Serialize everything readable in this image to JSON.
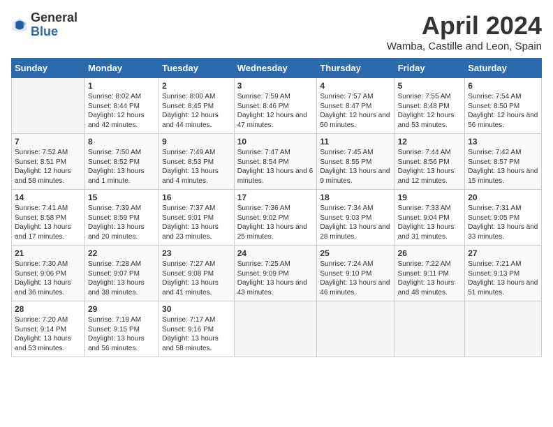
{
  "header": {
    "logo_general": "General",
    "logo_blue": "Blue",
    "month_title": "April 2024",
    "subtitle": "Wamba, Castille and Leon, Spain"
  },
  "days_of_week": [
    "Sunday",
    "Monday",
    "Tuesday",
    "Wednesday",
    "Thursday",
    "Friday",
    "Saturday"
  ],
  "weeks": [
    [
      {
        "num": "",
        "sunrise": "",
        "sunset": "",
        "daylight": "",
        "empty": true
      },
      {
        "num": "1",
        "sunrise": "Sunrise: 8:02 AM",
        "sunset": "Sunset: 8:44 PM",
        "daylight": "Daylight: 12 hours and 42 minutes."
      },
      {
        "num": "2",
        "sunrise": "Sunrise: 8:00 AM",
        "sunset": "Sunset: 8:45 PM",
        "daylight": "Daylight: 12 hours and 44 minutes."
      },
      {
        "num": "3",
        "sunrise": "Sunrise: 7:59 AM",
        "sunset": "Sunset: 8:46 PM",
        "daylight": "Daylight: 12 hours and 47 minutes."
      },
      {
        "num": "4",
        "sunrise": "Sunrise: 7:57 AM",
        "sunset": "Sunset: 8:47 PM",
        "daylight": "Daylight: 12 hours and 50 minutes."
      },
      {
        "num": "5",
        "sunrise": "Sunrise: 7:55 AM",
        "sunset": "Sunset: 8:48 PM",
        "daylight": "Daylight: 12 hours and 53 minutes."
      },
      {
        "num": "6",
        "sunrise": "Sunrise: 7:54 AM",
        "sunset": "Sunset: 8:50 PM",
        "daylight": "Daylight: 12 hours and 56 minutes."
      }
    ],
    [
      {
        "num": "7",
        "sunrise": "Sunrise: 7:52 AM",
        "sunset": "Sunset: 8:51 PM",
        "daylight": "Daylight: 12 hours and 58 minutes."
      },
      {
        "num": "8",
        "sunrise": "Sunrise: 7:50 AM",
        "sunset": "Sunset: 8:52 PM",
        "daylight": "Daylight: 13 hours and 1 minute."
      },
      {
        "num": "9",
        "sunrise": "Sunrise: 7:49 AM",
        "sunset": "Sunset: 8:53 PM",
        "daylight": "Daylight: 13 hours and 4 minutes."
      },
      {
        "num": "10",
        "sunrise": "Sunrise: 7:47 AM",
        "sunset": "Sunset: 8:54 PM",
        "daylight": "Daylight: 13 hours and 6 minutes."
      },
      {
        "num": "11",
        "sunrise": "Sunrise: 7:45 AM",
        "sunset": "Sunset: 8:55 PM",
        "daylight": "Daylight: 13 hours and 9 minutes."
      },
      {
        "num": "12",
        "sunrise": "Sunrise: 7:44 AM",
        "sunset": "Sunset: 8:56 PM",
        "daylight": "Daylight: 13 hours and 12 minutes."
      },
      {
        "num": "13",
        "sunrise": "Sunrise: 7:42 AM",
        "sunset": "Sunset: 8:57 PM",
        "daylight": "Daylight: 13 hours and 15 minutes."
      }
    ],
    [
      {
        "num": "14",
        "sunrise": "Sunrise: 7:41 AM",
        "sunset": "Sunset: 8:58 PM",
        "daylight": "Daylight: 13 hours and 17 minutes."
      },
      {
        "num": "15",
        "sunrise": "Sunrise: 7:39 AM",
        "sunset": "Sunset: 8:59 PM",
        "daylight": "Daylight: 13 hours and 20 minutes."
      },
      {
        "num": "16",
        "sunrise": "Sunrise: 7:37 AM",
        "sunset": "Sunset: 9:01 PM",
        "daylight": "Daylight: 13 hours and 23 minutes."
      },
      {
        "num": "17",
        "sunrise": "Sunrise: 7:36 AM",
        "sunset": "Sunset: 9:02 PM",
        "daylight": "Daylight: 13 hours and 25 minutes."
      },
      {
        "num": "18",
        "sunrise": "Sunrise: 7:34 AM",
        "sunset": "Sunset: 9:03 PM",
        "daylight": "Daylight: 13 hours and 28 minutes."
      },
      {
        "num": "19",
        "sunrise": "Sunrise: 7:33 AM",
        "sunset": "Sunset: 9:04 PM",
        "daylight": "Daylight: 13 hours and 31 minutes."
      },
      {
        "num": "20",
        "sunrise": "Sunrise: 7:31 AM",
        "sunset": "Sunset: 9:05 PM",
        "daylight": "Daylight: 13 hours and 33 minutes."
      }
    ],
    [
      {
        "num": "21",
        "sunrise": "Sunrise: 7:30 AM",
        "sunset": "Sunset: 9:06 PM",
        "daylight": "Daylight: 13 hours and 36 minutes."
      },
      {
        "num": "22",
        "sunrise": "Sunrise: 7:28 AM",
        "sunset": "Sunset: 9:07 PM",
        "daylight": "Daylight: 13 hours and 38 minutes."
      },
      {
        "num": "23",
        "sunrise": "Sunrise: 7:27 AM",
        "sunset": "Sunset: 9:08 PM",
        "daylight": "Daylight: 13 hours and 41 minutes."
      },
      {
        "num": "24",
        "sunrise": "Sunrise: 7:25 AM",
        "sunset": "Sunset: 9:09 PM",
        "daylight": "Daylight: 13 hours and 43 minutes."
      },
      {
        "num": "25",
        "sunrise": "Sunrise: 7:24 AM",
        "sunset": "Sunset: 9:10 PM",
        "daylight": "Daylight: 13 hours and 46 minutes."
      },
      {
        "num": "26",
        "sunrise": "Sunrise: 7:22 AM",
        "sunset": "Sunset: 9:11 PM",
        "daylight": "Daylight: 13 hours and 48 minutes."
      },
      {
        "num": "27",
        "sunrise": "Sunrise: 7:21 AM",
        "sunset": "Sunset: 9:13 PM",
        "daylight": "Daylight: 13 hours and 51 minutes."
      }
    ],
    [
      {
        "num": "28",
        "sunrise": "Sunrise: 7:20 AM",
        "sunset": "Sunset: 9:14 PM",
        "daylight": "Daylight: 13 hours and 53 minutes."
      },
      {
        "num": "29",
        "sunrise": "Sunrise: 7:18 AM",
        "sunset": "Sunset: 9:15 PM",
        "daylight": "Daylight: 13 hours and 56 minutes."
      },
      {
        "num": "30",
        "sunrise": "Sunrise: 7:17 AM",
        "sunset": "Sunset: 9:16 PM",
        "daylight": "Daylight: 13 hours and 58 minutes."
      },
      {
        "num": "",
        "sunrise": "",
        "sunset": "",
        "daylight": "",
        "empty": true
      },
      {
        "num": "",
        "sunrise": "",
        "sunset": "",
        "daylight": "",
        "empty": true
      },
      {
        "num": "",
        "sunrise": "",
        "sunset": "",
        "daylight": "",
        "empty": true
      },
      {
        "num": "",
        "sunrise": "",
        "sunset": "",
        "daylight": "",
        "empty": true
      }
    ]
  ]
}
